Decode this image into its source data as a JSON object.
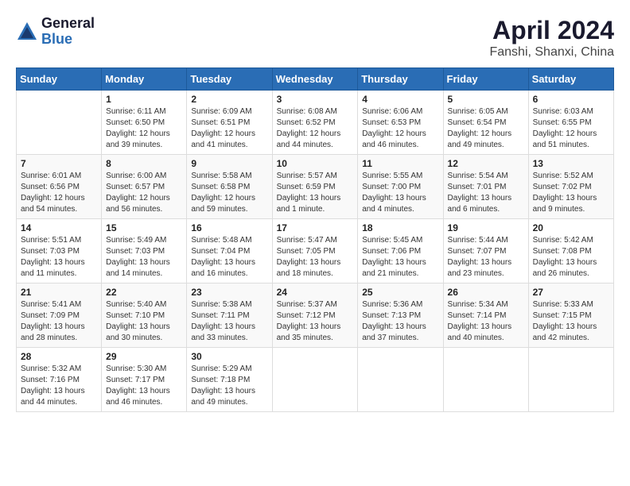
{
  "header": {
    "logo_general": "General",
    "logo_blue": "Blue",
    "month_title": "April 2024",
    "location": "Fanshi, Shanxi, China"
  },
  "weekdays": [
    "Sunday",
    "Monday",
    "Tuesday",
    "Wednesday",
    "Thursday",
    "Friday",
    "Saturday"
  ],
  "weeks": [
    [
      {
        "day": "",
        "info": ""
      },
      {
        "day": "1",
        "info": "Sunrise: 6:11 AM\nSunset: 6:50 PM\nDaylight: 12 hours\nand 39 minutes."
      },
      {
        "day": "2",
        "info": "Sunrise: 6:09 AM\nSunset: 6:51 PM\nDaylight: 12 hours\nand 41 minutes."
      },
      {
        "day": "3",
        "info": "Sunrise: 6:08 AM\nSunset: 6:52 PM\nDaylight: 12 hours\nand 44 minutes."
      },
      {
        "day": "4",
        "info": "Sunrise: 6:06 AM\nSunset: 6:53 PM\nDaylight: 12 hours\nand 46 minutes."
      },
      {
        "day": "5",
        "info": "Sunrise: 6:05 AM\nSunset: 6:54 PM\nDaylight: 12 hours\nand 49 minutes."
      },
      {
        "day": "6",
        "info": "Sunrise: 6:03 AM\nSunset: 6:55 PM\nDaylight: 12 hours\nand 51 minutes."
      }
    ],
    [
      {
        "day": "7",
        "info": "Sunrise: 6:01 AM\nSunset: 6:56 PM\nDaylight: 12 hours\nand 54 minutes."
      },
      {
        "day": "8",
        "info": "Sunrise: 6:00 AM\nSunset: 6:57 PM\nDaylight: 12 hours\nand 56 minutes."
      },
      {
        "day": "9",
        "info": "Sunrise: 5:58 AM\nSunset: 6:58 PM\nDaylight: 12 hours\nand 59 minutes."
      },
      {
        "day": "10",
        "info": "Sunrise: 5:57 AM\nSunset: 6:59 PM\nDaylight: 13 hours\nand 1 minute."
      },
      {
        "day": "11",
        "info": "Sunrise: 5:55 AM\nSunset: 7:00 PM\nDaylight: 13 hours\nand 4 minutes."
      },
      {
        "day": "12",
        "info": "Sunrise: 5:54 AM\nSunset: 7:01 PM\nDaylight: 13 hours\nand 6 minutes."
      },
      {
        "day": "13",
        "info": "Sunrise: 5:52 AM\nSunset: 7:02 PM\nDaylight: 13 hours\nand 9 minutes."
      }
    ],
    [
      {
        "day": "14",
        "info": "Sunrise: 5:51 AM\nSunset: 7:03 PM\nDaylight: 13 hours\nand 11 minutes."
      },
      {
        "day": "15",
        "info": "Sunrise: 5:49 AM\nSunset: 7:03 PM\nDaylight: 13 hours\nand 14 minutes."
      },
      {
        "day": "16",
        "info": "Sunrise: 5:48 AM\nSunset: 7:04 PM\nDaylight: 13 hours\nand 16 minutes."
      },
      {
        "day": "17",
        "info": "Sunrise: 5:47 AM\nSunset: 7:05 PM\nDaylight: 13 hours\nand 18 minutes."
      },
      {
        "day": "18",
        "info": "Sunrise: 5:45 AM\nSunset: 7:06 PM\nDaylight: 13 hours\nand 21 minutes."
      },
      {
        "day": "19",
        "info": "Sunrise: 5:44 AM\nSunset: 7:07 PM\nDaylight: 13 hours\nand 23 minutes."
      },
      {
        "day": "20",
        "info": "Sunrise: 5:42 AM\nSunset: 7:08 PM\nDaylight: 13 hours\nand 26 minutes."
      }
    ],
    [
      {
        "day": "21",
        "info": "Sunrise: 5:41 AM\nSunset: 7:09 PM\nDaylight: 13 hours\nand 28 minutes."
      },
      {
        "day": "22",
        "info": "Sunrise: 5:40 AM\nSunset: 7:10 PM\nDaylight: 13 hours\nand 30 minutes."
      },
      {
        "day": "23",
        "info": "Sunrise: 5:38 AM\nSunset: 7:11 PM\nDaylight: 13 hours\nand 33 minutes."
      },
      {
        "day": "24",
        "info": "Sunrise: 5:37 AM\nSunset: 7:12 PM\nDaylight: 13 hours\nand 35 minutes."
      },
      {
        "day": "25",
        "info": "Sunrise: 5:36 AM\nSunset: 7:13 PM\nDaylight: 13 hours\nand 37 minutes."
      },
      {
        "day": "26",
        "info": "Sunrise: 5:34 AM\nSunset: 7:14 PM\nDaylight: 13 hours\nand 40 minutes."
      },
      {
        "day": "27",
        "info": "Sunrise: 5:33 AM\nSunset: 7:15 PM\nDaylight: 13 hours\nand 42 minutes."
      }
    ],
    [
      {
        "day": "28",
        "info": "Sunrise: 5:32 AM\nSunset: 7:16 PM\nDaylight: 13 hours\nand 44 minutes."
      },
      {
        "day": "29",
        "info": "Sunrise: 5:30 AM\nSunset: 7:17 PM\nDaylight: 13 hours\nand 46 minutes."
      },
      {
        "day": "30",
        "info": "Sunrise: 5:29 AM\nSunset: 7:18 PM\nDaylight: 13 hours\nand 49 minutes."
      },
      {
        "day": "",
        "info": ""
      },
      {
        "day": "",
        "info": ""
      },
      {
        "day": "",
        "info": ""
      },
      {
        "day": "",
        "info": ""
      }
    ]
  ]
}
